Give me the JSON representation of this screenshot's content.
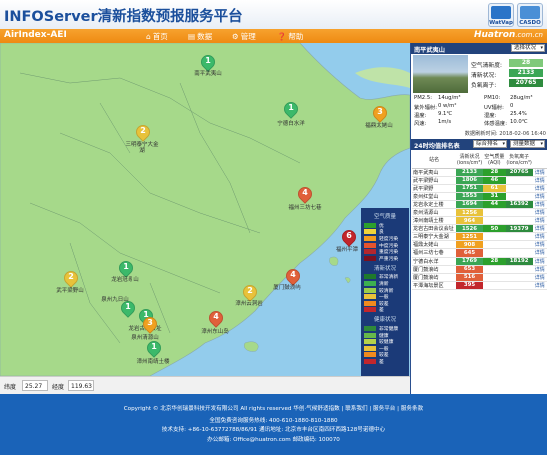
{
  "header": {
    "title": "INFOServer清新指数预报服务平台",
    "logos": [
      {
        "name": "WatVap",
        "color": "#2a74c8"
      },
      {
        "name": "CASDO",
        "color": "#4a8fd6"
      }
    ]
  },
  "nav": {
    "app_title": "AirIndex-AEI",
    "items": [
      {
        "icon": "home-icon",
        "glyph": "⌂",
        "label": "首页"
      },
      {
        "icon": "data-icon",
        "glyph": "▤",
        "label": "数据"
      },
      {
        "icon": "manage-icon",
        "glyph": "⚙",
        "label": "管理"
      },
      {
        "icon": "help-icon",
        "glyph": "❓",
        "label": "帮助"
      }
    ],
    "brand": "Huatron",
    "brand_suffix": ".com.cn"
  },
  "map": {
    "markers": [
      {
        "value": "1",
        "color": "#3cb96a",
        "label": "南平武夷山"
      },
      {
        "value": "1",
        "color": "#3cb96a",
        "label": "宁德白水洋"
      },
      {
        "value": "3",
        "color": "#f0a020",
        "label": "福鼎太姥山"
      },
      {
        "value": "2",
        "color": "#e8c23a",
        "label": "三明泰宁大金湖"
      },
      {
        "value": "4",
        "color": "#e0603a",
        "label": "福州三坊七巷"
      },
      {
        "value": "6",
        "color": "#c2262c",
        "label": "福州平潭"
      },
      {
        "value": "1",
        "color": "#3cb96a",
        "label": "龙岩冠豸山"
      },
      {
        "value": "2",
        "color": "#e8c23a",
        "label": "武平梁野山"
      },
      {
        "value": "1",
        "color": "#3cb96a",
        "label": "龙岩古田会址"
      },
      {
        "value": "3",
        "color": "#f0a020",
        "label": "泉州清源山"
      },
      {
        "value": "2",
        "color": "#e8c23a",
        "label": "漳州云洞岩"
      },
      {
        "value": "4",
        "color": "#e0603a",
        "label": "厦门鼓浪屿"
      },
      {
        "value": "4",
        "color": "#e0603a",
        "label": "漳州东山岛"
      },
      {
        "value": "1",
        "color": "#3cb96a",
        "label": "泉州九日山"
      },
      {
        "value": "1",
        "color": "#3cb96a",
        "label": "漳州南靖土楼"
      }
    ]
  },
  "legend": {
    "title_aq": "空气质量",
    "aq_items": [
      {
        "color": "#2ca02c",
        "label": "优"
      },
      {
        "color": "#f0d43a",
        "label": "良"
      },
      {
        "color": "#f39c1e",
        "label": "轻度污染"
      },
      {
        "color": "#e5542e",
        "label": "中度污染"
      },
      {
        "color": "#b3262e",
        "label": "重度污染"
      },
      {
        "color": "#7a1020",
        "label": "严重污染"
      }
    ],
    "title_fresh": "清新状况",
    "fresh_items": [
      {
        "color": "#1e7a2c",
        "label": "非常清新"
      },
      {
        "color": "#3cb050",
        "label": "清新"
      },
      {
        "color": "#9acd4a",
        "label": "较清新"
      },
      {
        "color": "#e8c23a",
        "label": "一般"
      },
      {
        "color": "#f08a1e",
        "label": "较差"
      },
      {
        "color": "#c2262c",
        "label": "差"
      }
    ],
    "title_health": "健康状况",
    "health_items": [
      {
        "color": "#2f8a3a",
        "label": "非常健康"
      },
      {
        "color": "#66b84a",
        "label": "健康"
      },
      {
        "color": "#b5d24a",
        "label": "较健康"
      },
      {
        "color": "#e8c23a",
        "label": "一般"
      },
      {
        "color": "#f08a1e",
        "label": "较差"
      },
      {
        "color": "#c2262c",
        "label": "差"
      }
    ]
  },
  "coords": {
    "lat_label": "纬度",
    "lat_value": "25.27",
    "lon_label": "经度",
    "lon_value": "119.63"
  },
  "station": {
    "name": "南平武夷山",
    "select": "选择状况",
    "indices": [
      {
        "label": "空气清新度:",
        "value": "28",
        "color": "#7fc97a"
      },
      {
        "label": "清新状况:",
        "value": "2133",
        "color": "#3ba655"
      },
      {
        "label": "负氧离子:",
        "value": "20765",
        "color": "#2e8b3e"
      }
    ],
    "meteo": [
      [
        "PM2.5:",
        "14ug/m³",
        "PM10:",
        "28ug/m³"
      ],
      [
        "紫外辐射:",
        "0 w/m²",
        "UV辐射:",
        "0"
      ],
      [
        "温度:",
        "9.1℃",
        "湿度:",
        "25.4%"
      ],
      [
        "风速:",
        "1m/s",
        "体感温度:",
        "10.0℃"
      ]
    ],
    "pub_time": "数据刷新时间: 2018-02-06 16:40"
  },
  "ranking": {
    "title": "24时均值排名表",
    "select1": "综合排名",
    "select2": "测量数据",
    "headers": [
      "站名",
      "清新状况(ions/cm³)",
      "空气质量(AQI)",
      "负氧离子(ions/cm³)",
      ""
    ],
    "rows": [
      {
        "name": "南平武夷山",
        "fresh": "2133",
        "aqi": "28",
        "ion": "20765",
        "c1": "#3ba655",
        "c2": "#2ca02c",
        "detail": "详情"
      },
      {
        "name": "武平梁野山",
        "fresh": "1806",
        "aqi": "46",
        "ion": "",
        "c1": "#3ba655",
        "c2": "#2ca02c",
        "detail": "详情"
      },
      {
        "name": "武平梁野",
        "fresh": "1751",
        "aqi": "61",
        "ion": "",
        "c1": "#3ba655",
        "c2": "#e8c23a",
        "detail": "详情"
      },
      {
        "name": "泉州红堂山",
        "fresh": "1553",
        "aqi": "31",
        "ion": "",
        "c1": "#3ba655",
        "c2": "#2ca02c",
        "detail": "详情"
      },
      {
        "name": "龙岩永定土楼",
        "fresh": "1694",
        "aqi": "44",
        "ion": "16392",
        "c1": "#3ba655",
        "c2": "#2ca02c",
        "detail": "详情"
      },
      {
        "name": "泉州清源山",
        "fresh": "1256",
        "aqi": "",
        "ion": "",
        "c1": "#e8c23a",
        "c2": "#ffffff",
        "detail": "详情"
      },
      {
        "name": "漳州南靖土楼",
        "fresh": "964",
        "aqi": "",
        "ion": "",
        "c1": "#e8c23a",
        "c2": "#ffffff",
        "detail": "详情"
      },
      {
        "name": "龙岩古田会议会址",
        "fresh": "1526",
        "aqi": "50",
        "ion": "19379",
        "c1": "#3ba655",
        "c2": "#2ca02c",
        "detail": "详情"
      },
      {
        "name": "三明泰宁大金湖",
        "fresh": "1251",
        "aqi": "",
        "ion": "",
        "c1": "#f0a020",
        "c2": "#ffffff",
        "detail": "详情"
      },
      {
        "name": "福鼎太姥山",
        "fresh": "908",
        "aqi": "",
        "ion": "",
        "c1": "#f0a020",
        "c2": "#ffffff",
        "detail": "详情"
      },
      {
        "name": "福州三坊七巷",
        "fresh": "645",
        "aqi": "",
        "ion": "",
        "c1": "#e0603a",
        "c2": "#ffffff",
        "detail": "详情"
      },
      {
        "name": "宁德白水洋",
        "fresh": "1769",
        "aqi": "28",
        "ion": "18192",
        "c1": "#3ba655",
        "c2": "#2ca02c",
        "detail": "详情"
      },
      {
        "name": "厦门鼓浪屿",
        "fresh": "653",
        "aqi": "",
        "ion": "",
        "c1": "#e0603a",
        "c2": "#ffffff",
        "detail": "详情"
      },
      {
        "name": "厦门鼓浪屿",
        "fresh": "516",
        "aqi": "",
        "ion": "",
        "c1": "#e0603a",
        "c2": "#ffffff",
        "detail": "详情"
      },
      {
        "name": "平潭海坛景区",
        "fresh": "395",
        "aqi": "",
        "ion": "",
        "c1": "#c2262c",
        "c2": "#ffffff",
        "detail": "详情"
      }
    ]
  },
  "footer": {
    "line1": "Copyright © 北京华创瑞景科技开发有限公司   All rights reserved   华创·气候舒适指数 | 联系我们 | 服务平台 | 服务条款",
    "line2": "全国免费咨询服务热线: 400-610-1880-810-1880",
    "line3": "技术支持: +86-10-63772788/86/91   通讯地址: 北京市丰台区南四环西路128号诺德中心",
    "line4": "办公邮箱: Office@huatron.com    邮政编码: 100070"
  }
}
